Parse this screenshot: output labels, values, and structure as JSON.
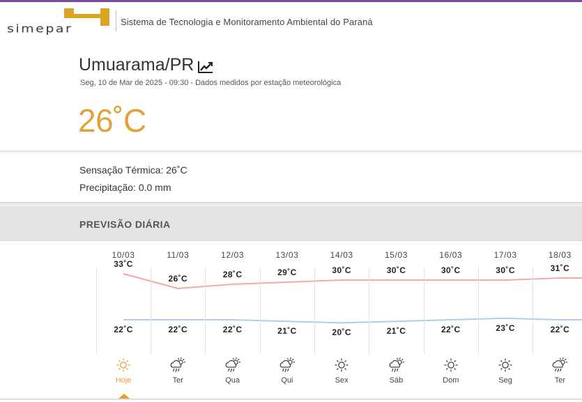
{
  "header": {
    "logo_text": "simepar",
    "subtitle": "Sistema de Tecnologia e Monitoramento Ambiental do Paraná"
  },
  "current": {
    "city": "Umuarama/PR",
    "date_line": "Seg, 10 de Mar de 2025 - 09:30 - Dados medidos por estação meteorológica",
    "temperature": "26˚C",
    "feels_like": "Sensação Térmica: 26˚C",
    "precipitation": "Precipitação: 0.0 mm"
  },
  "daily": {
    "title": "PREVISÃO DIÁRIA",
    "days": [
      {
        "date": "10/03",
        "max": "33˚C",
        "min": "22˚C",
        "label": "Hoje",
        "icon": "sun-icon",
        "max_value": 33,
        "min_value": 22
      },
      {
        "date": "11/03",
        "max": "26˚C",
        "min": "22˚C",
        "label": "Ter",
        "icon": "cloud-rain-sun-icon",
        "max_value": 26,
        "min_value": 22
      },
      {
        "date": "12/03",
        "max": "28˚C",
        "min": "22˚C",
        "label": "Qua",
        "icon": "cloud-rain-sun-icon",
        "max_value": 28,
        "min_value": 22
      },
      {
        "date": "13/03",
        "max": "29˚C",
        "min": "21˚C",
        "label": "Qui",
        "icon": "cloud-rain-sun-icon",
        "max_value": 29,
        "min_value": 21
      },
      {
        "date": "14/03",
        "max": "30˚C",
        "min": "20˚C",
        "label": "Sex",
        "icon": "sun-icon",
        "max_value": 30,
        "min_value": 20
      },
      {
        "date": "15/03",
        "max": "30˚C",
        "min": "21˚C",
        "label": "Sáb",
        "icon": "cloud-rain-sun-icon",
        "max_value": 30,
        "min_value": 21
      },
      {
        "date": "16/03",
        "max": "30˚C",
        "min": "22˚C",
        "label": "Dom",
        "icon": "sun-icon",
        "max_value": 30,
        "min_value": 22
      },
      {
        "date": "17/03",
        "max": "30˚C",
        "min": "23˚C",
        "label": "Seg",
        "icon": "sun-icon",
        "max_value": 30,
        "min_value": 23
      },
      {
        "date": "18/03",
        "max": "31˚C",
        "min": "22˚C",
        "label": "Ter",
        "icon": "cloud-rain-sun-icon",
        "max_value": 31,
        "min_value": 22
      }
    ]
  },
  "colors": {
    "accent": "#e0a33a",
    "max_line": "#f2a9a9",
    "min_line": "#a9cdea",
    "brand_purple": "#7a4a9a"
  }
}
